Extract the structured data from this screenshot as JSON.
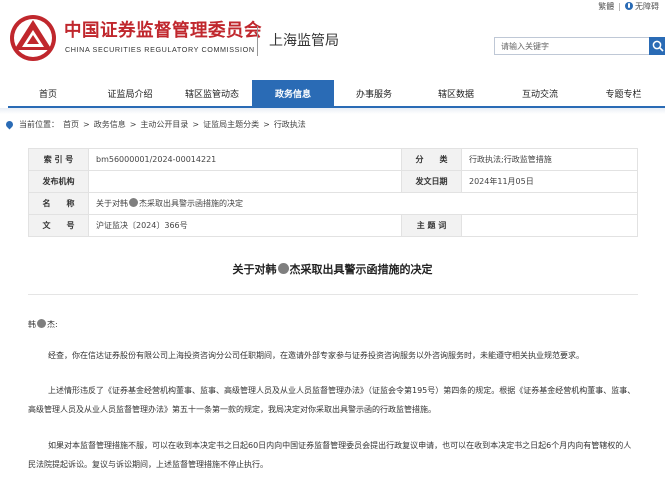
{
  "utility": {
    "traditional": "繁體",
    "accessibility": "无障碍"
  },
  "header": {
    "org_cn": "中国证券监督管理委员会",
    "org_en": "CHINA SECURITIES REGULATORY COMMISSION",
    "subtitle": "上海监管局",
    "search_placeholder": "请输入关键字",
    "brand_color": "#c0272d",
    "accent_color": "#2a6bb5"
  },
  "nav": {
    "items": [
      {
        "label": "首页"
      },
      {
        "label": "证监局介绍"
      },
      {
        "label": "辖区监管动态"
      },
      {
        "label": "政务信息",
        "active": true
      },
      {
        "label": "办事服务"
      },
      {
        "label": "辖区数据"
      },
      {
        "label": "互动交流"
      },
      {
        "label": "专题专栏"
      }
    ]
  },
  "breadcrumb": {
    "prefix": "当前位置：",
    "items": [
      "首页",
      "政务信息",
      "主动公开目录",
      "证监局主题分类",
      "行政执法"
    ],
    "separator": ">"
  },
  "info_table": {
    "index_label": "索 引 号",
    "index_value": "bm56000001/2024-00014221",
    "category_label": "分　　类",
    "category_value": "行政执法;行政监管措施",
    "issuer_label": "发布机构",
    "issuer_value": "",
    "date_label": "发文日期",
    "date_value": "2024年11月05日",
    "name_label": "名　　称",
    "name_before": "关于对韩",
    "name_after": "杰采取出具警示函措施的决定",
    "docno_label": "文　　号",
    "docno_value": "沪证监决〔2024〕366号",
    "subject_label": "主 题 词",
    "subject_value": ""
  },
  "document": {
    "title_before": "关于对韩",
    "title_after": "杰采取出具警示函措施的决定",
    "salutation_before": "韩",
    "salutation_after": "杰:",
    "p1": "经查，你在信达证券股份有限公司上海投资咨询分公司任职期间，在邀请外部专家参与证券投资咨询服务以外咨询服务时，未能遵守相关执业规范要求。",
    "p2": "上述情形违反了《证券基金经营机构董事、监事、高级管理人员及从业人员监督管理办法》（证监会令第195号）第四条的规定。根据《证券基金经营机构董事、监事、高级管理人员及从业人员监督管理办法》第五十一条第一款的规定，我局决定对你采取出具警示函的行政监管措施。",
    "p3": "如果对本监督管理措施不服，可以在收到本决定书之日起60日内向中国证券监督管理委员会提出行政复议申请，也可以在收到本决定书之日起6个月内向有管辖权的人民法院提起诉讼。复议与诉讼期间，上述监督管理措施不停止执行。"
  }
}
